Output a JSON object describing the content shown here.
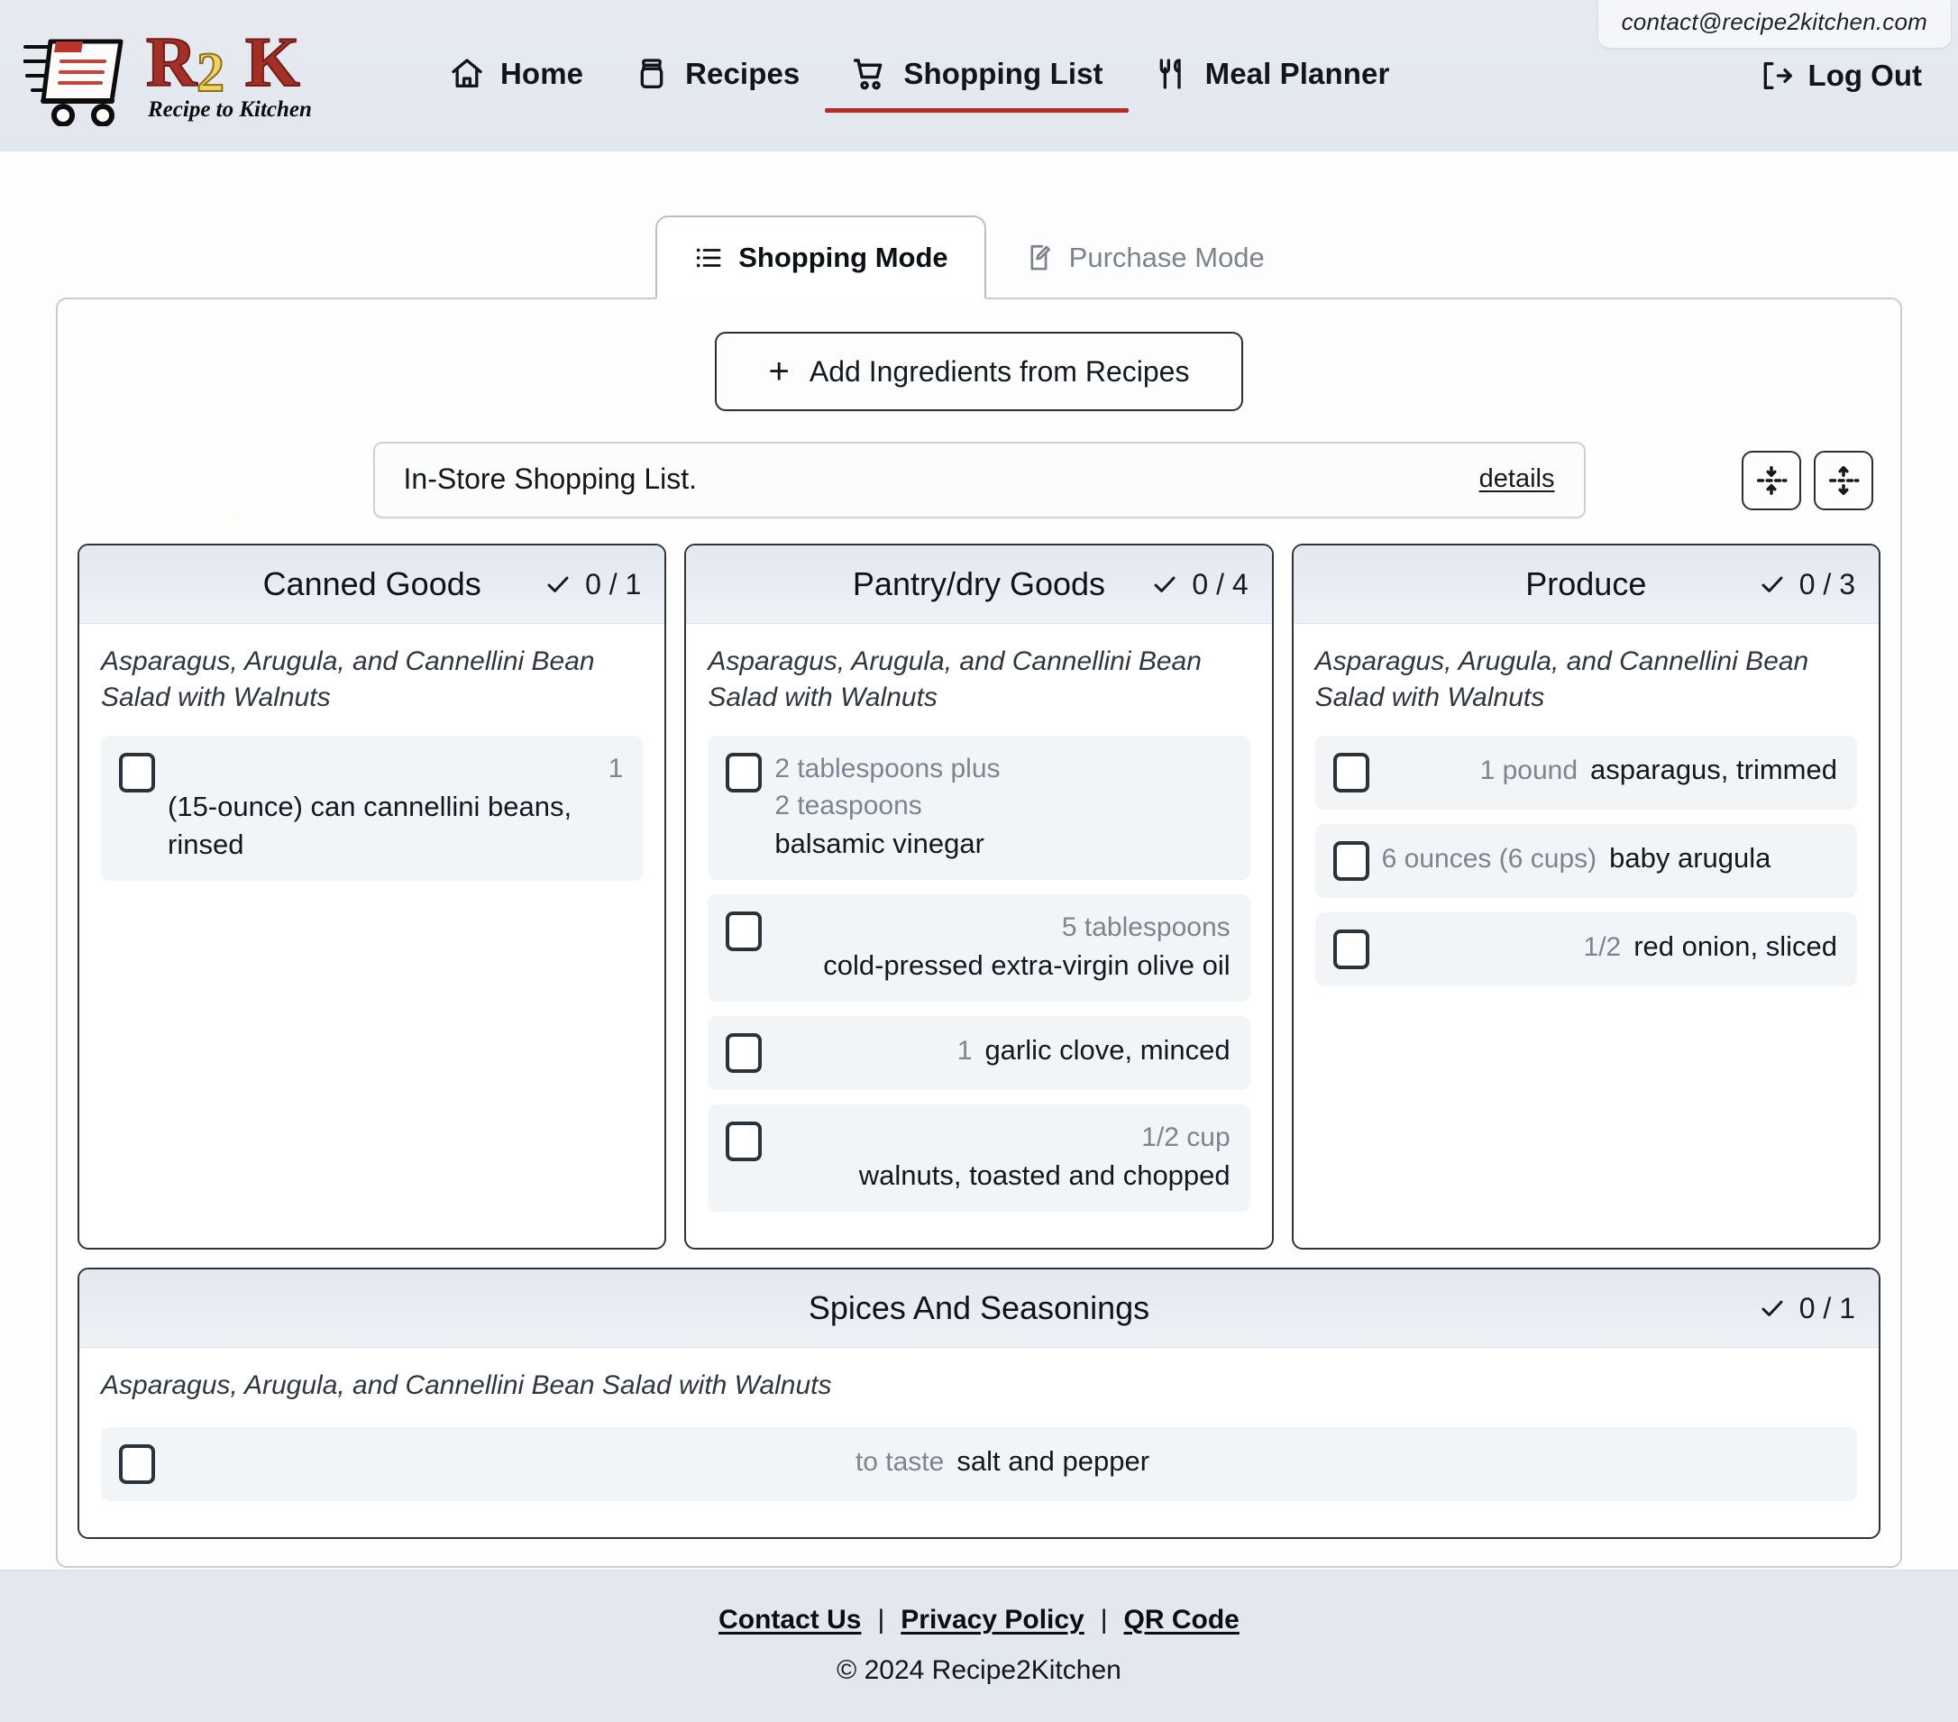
{
  "header": {
    "email_badge": "contact@recipe2kitchen.com",
    "logo_title": "R2K",
    "logo_subtitle": "Recipe to Kitchen",
    "nav": [
      {
        "label": "Home",
        "icon": "home-icon",
        "active": false
      },
      {
        "label": "Recipes",
        "icon": "jar-icon",
        "active": false
      },
      {
        "label": "Shopping List",
        "icon": "shopping-cart-icon",
        "active": true
      },
      {
        "label": "Meal Planner",
        "icon": "fork-knife-icon",
        "active": false
      }
    ],
    "logout_label": "Log Out",
    "logout_icon": "logout-icon",
    "active_accent": "#b32d22"
  },
  "tabs": [
    {
      "label": "Shopping Mode",
      "icon": "list-icon",
      "active": true
    },
    {
      "label": "Purchase Mode",
      "icon": "edit-document-icon",
      "active": false
    }
  ],
  "toolbar": {
    "add_label": "Add Ingredients from Recipes",
    "add_icon": "plus-icon",
    "list_name": "In-Store Shopping List.",
    "details_label": "details",
    "collapse_icon": "collapse-all-icon",
    "expand_icon": "expand-all-icon"
  },
  "categories": [
    {
      "title": "Canned Goods",
      "checked": 0,
      "total": 1,
      "count_label": "0 / 1",
      "recipe": "Asparagus, Arugula, and Cannellini Bean Salad with Walnuts",
      "items": [
        {
          "qty": "1",
          "name": "(15-ounce) can cannellini beans, rinsed",
          "checked": false
        }
      ]
    },
    {
      "title": "Pantry/dry Goods",
      "checked": 0,
      "total": 4,
      "count_label": "0 / 4",
      "recipe": "Asparagus, Arugula, and Cannellini Bean Salad with Walnuts",
      "items": [
        {
          "qty": "2 tablespoons plus 2 teaspoons",
          "name": "balsamic vinegar",
          "checked": false
        },
        {
          "qty": "5 tablespoons",
          "name": "cold-pressed extra-virgin olive oil",
          "checked": false
        },
        {
          "qty": "1",
          "name": "garlic clove, minced",
          "checked": false
        },
        {
          "qty": "1/2 cup",
          "name": "walnuts, toasted and chopped",
          "checked": false
        }
      ]
    },
    {
      "title": "Produce",
      "checked": 0,
      "total": 3,
      "count_label": "0 / 3",
      "recipe": "Asparagus, Arugula, and Cannellini Bean Salad with Walnuts",
      "items": [
        {
          "qty": "1 pound",
          "name": "asparagus, trimmed",
          "checked": false
        },
        {
          "qty": "6 ounces (6 cups)",
          "name": "baby arugula",
          "checked": false
        },
        {
          "qty": "1/2",
          "name": "red onion, sliced",
          "checked": false
        }
      ]
    }
  ],
  "wide_category": {
    "title": "Spices And Seasonings",
    "checked": 0,
    "total": 1,
    "count_label": "0 / 1",
    "recipe": "Asparagus, Arugula, and Cannellini Bean Salad with Walnuts",
    "items": [
      {
        "qty": "to taste",
        "name": "salt and pepper",
        "checked": false
      }
    ]
  },
  "footer": {
    "links": [
      {
        "label": "Contact Us"
      },
      {
        "label": "Privacy Policy"
      },
      {
        "label": "QR Code"
      }
    ],
    "separator": "|",
    "copyright": "© 2024 Recipe2Kitchen"
  }
}
